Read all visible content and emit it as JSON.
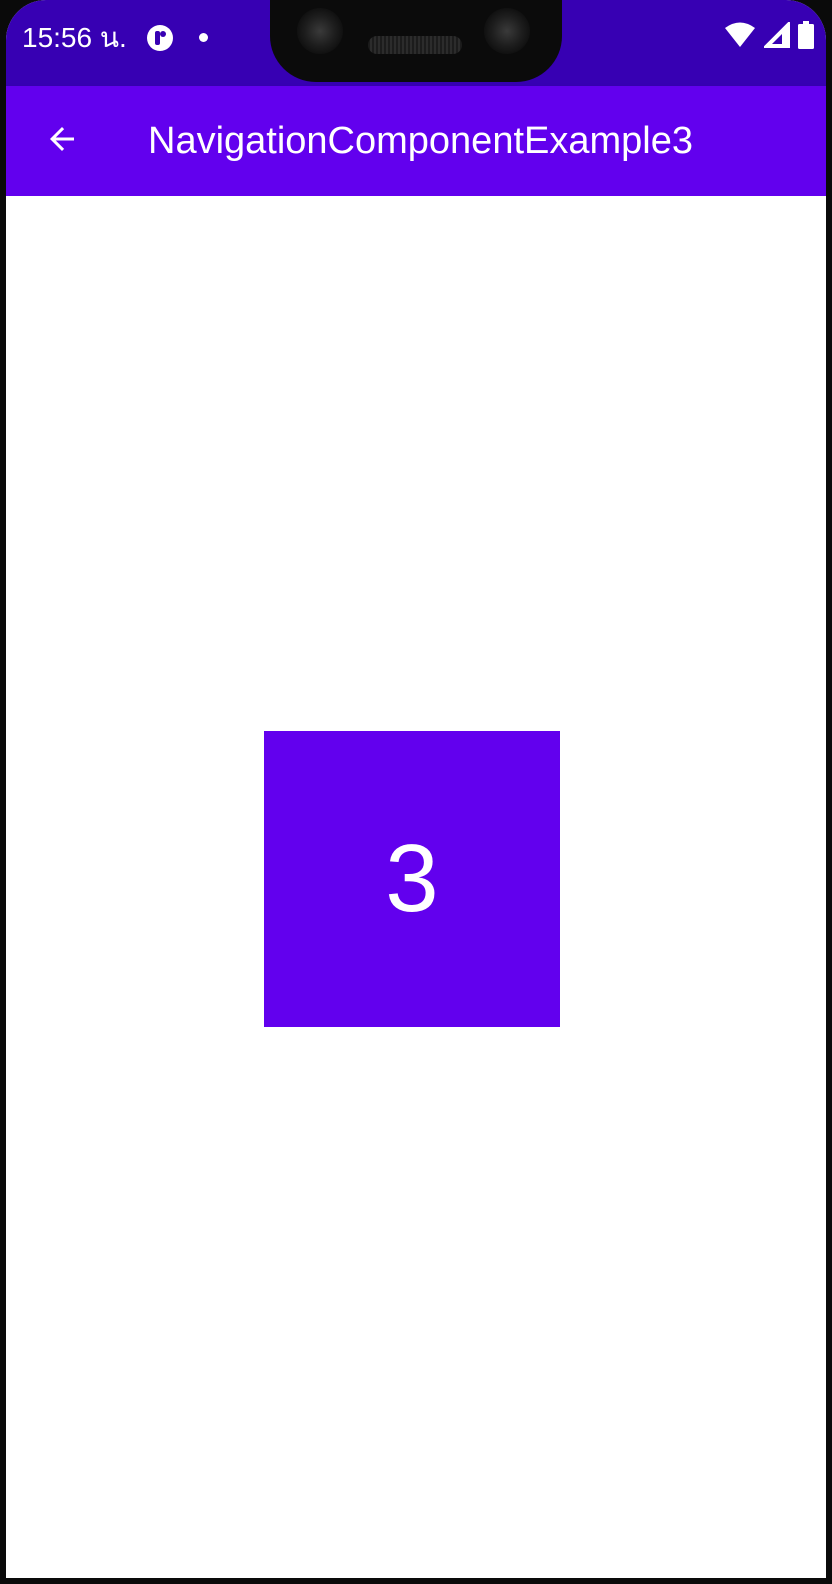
{
  "status_bar": {
    "time": "15:56 น.",
    "notification_icon": "app-notification-icon",
    "dot_icon": "notification-dot-icon",
    "wifi_icon": "wifi-icon",
    "signal_icon": "cell-signal-icon",
    "battery_icon": "battery-icon",
    "background_color": "#3700B3"
  },
  "app_bar": {
    "back_icon": "arrow-back-icon",
    "title": "NavigationComponentExample3",
    "background_color": "#6200EE"
  },
  "main": {
    "number": "3",
    "box_color": "#6200EE"
  }
}
